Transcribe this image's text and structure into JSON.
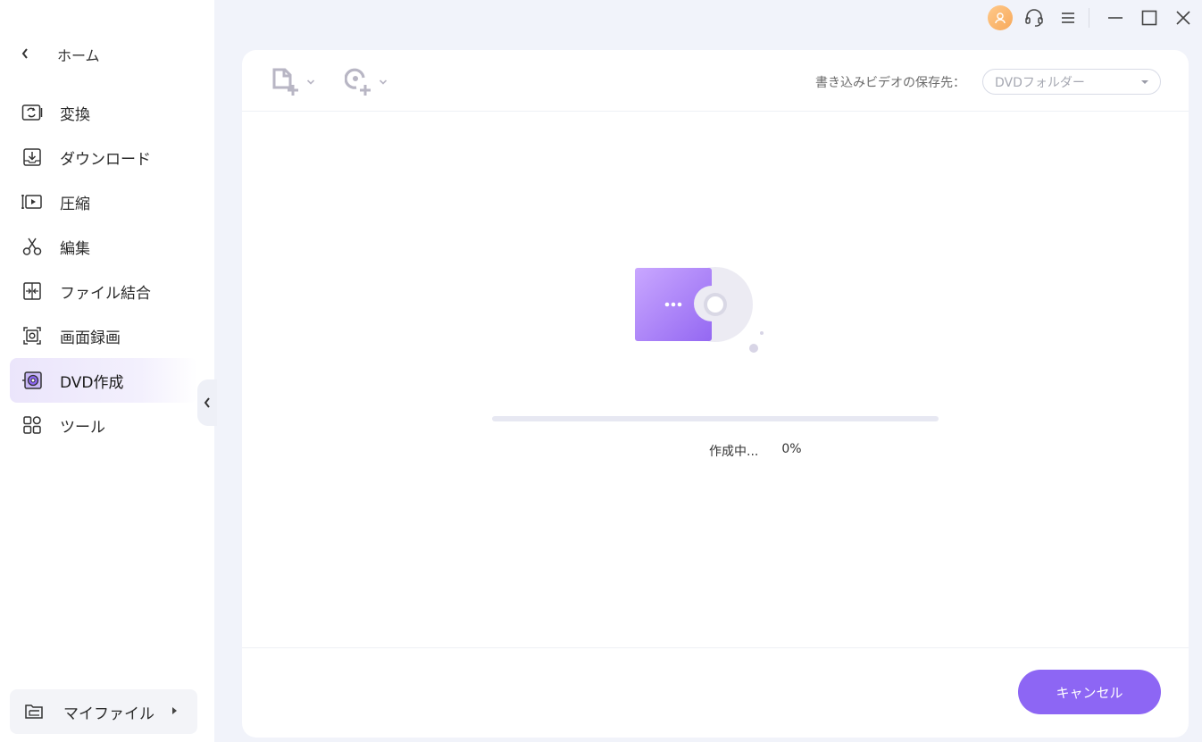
{
  "sidebar": {
    "home_label": "ホーム",
    "items": [
      {
        "label": "変換",
        "icon": "convert-icon"
      },
      {
        "label": "ダウンロード",
        "icon": "download-icon"
      },
      {
        "label": "圧縮",
        "icon": "compress-icon"
      },
      {
        "label": "編集",
        "icon": "scissors-icon"
      },
      {
        "label": "ファイル結合",
        "icon": "merge-icon"
      },
      {
        "label": "画面録画",
        "icon": "screen-record-icon"
      },
      {
        "label": "DVD作成",
        "icon": "dvd-icon",
        "active": true
      },
      {
        "label": "ツール",
        "icon": "toolbox-icon"
      }
    ],
    "my_files_label": "マイファイル"
  },
  "toolbar": {
    "destination_label": "書き込みビデオの保存先：",
    "destination_value": "DVDフォルダー"
  },
  "progress": {
    "status_text": "作成中...",
    "percent_text": "0%",
    "percent": 0
  },
  "footer": {
    "cancel_label": "キャンセル"
  },
  "colors": {
    "accent": "#8d66f4",
    "active_nav": "#ebe5fb",
    "avatar": "#f7a95b",
    "background": "#f1f3fa"
  }
}
